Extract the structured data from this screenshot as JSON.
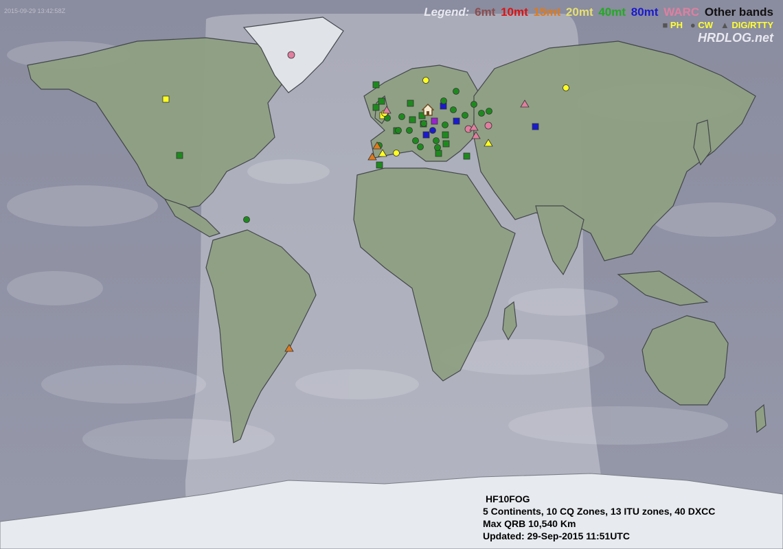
{
  "timestamp": "2015-09-29 13:42:58Z",
  "legend": {
    "label": "Legend:",
    "bands": [
      {
        "name": "6mt",
        "color": "#8b4d4d"
      },
      {
        "name": "10mt",
        "color": "#dd1111"
      },
      {
        "name": "15mt",
        "color": "#e07a1a"
      },
      {
        "name": "20mt",
        "color": "#e6e070"
      },
      {
        "name": "40mt",
        "color": "#22aa22"
      },
      {
        "name": "80mt",
        "color": "#1a1acc"
      },
      {
        "name": "WARC",
        "color": "#e07fa0"
      },
      {
        "name": "Other bands",
        "color": "#111111"
      }
    ],
    "modes": [
      {
        "symbol": "■",
        "name": "PH"
      },
      {
        "symbol": "●",
        "name": "CW"
      },
      {
        "symbol": "▲",
        "name": "DIG/RTTY"
      }
    ],
    "site": "HRDLOG.net"
  },
  "info": {
    "callsign": "HF10FOG",
    "stats": "5 Continents, 10 CQ Zones, 13 ITU zones, 40 DXCC",
    "max_qrb": "Max QRB 10,540 Km",
    "updated": "Updated: 29-Sep-2015 11:51UTC"
  }
}
